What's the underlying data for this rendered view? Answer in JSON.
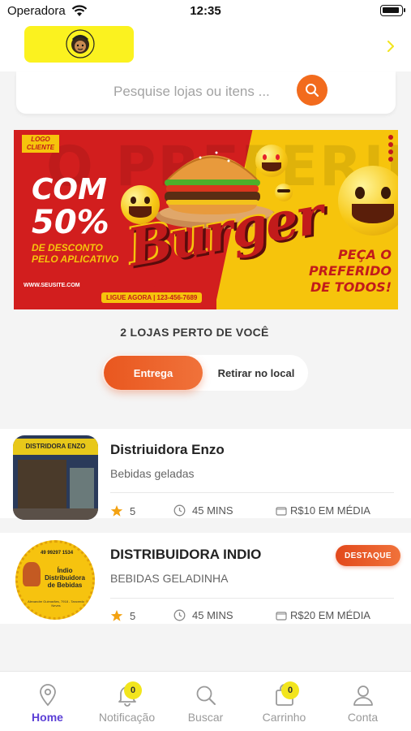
{
  "status_bar": {
    "carrier": "Operadora",
    "time": "12:35"
  },
  "header": {
    "logo_icon": "brand-logo-icon",
    "chevron_icon": "chevron-right-icon"
  },
  "search": {
    "placeholder": "Pesquise lojas ou itens ...",
    "icon": "search-icon"
  },
  "banner": {
    "logo_label": "LOGO CLIENTE",
    "headline_com": "COM",
    "headline_pct": "50%",
    "subline": "DE DESCONTO PELO APLICATIVO",
    "website": "WWW.SEUSITE.COM",
    "phone": "LIGUE AGORA | 123-456-7689",
    "title": "Burger",
    "right_text": "PEÇA O PREFERIDO DE TODOS!",
    "background_text": "O PREFERIDO"
  },
  "stores_heading": "2 LOJAS PERTO DE VOCÊ",
  "delivery_toggle": {
    "active": "Entrega",
    "inactive": "Retirar no local"
  },
  "stores": [
    {
      "name": "Distriuidora Enzo",
      "description": "Bebidas geladas",
      "rating": "5",
      "time": "45 MINS",
      "price": "R$10 EM MÉDIA",
      "badge": "",
      "thumb_sign": "DISTRIDORA ENZO"
    },
    {
      "name": "DISTRIBUIDORA INDIO",
      "description": "BEBIDAS GELADINHA",
      "rating": "5",
      "time": "45 MINS",
      "price": "R$20 EM MÉDIA",
      "badge": "DESTAQUE",
      "thumb_phone": "49 99297 1534",
      "thumb_title": "Índio Distribuidora de Bebidas",
      "thumb_address": "Alexandre Guimarães, 7918 - Tancredo Neves"
    }
  ],
  "tabbar": {
    "items": [
      {
        "label": "Home",
        "icon": "location-pin-icon",
        "active": true
      },
      {
        "label": "Notificação",
        "icon": "bell-icon",
        "count": "0"
      },
      {
        "label": "Buscar",
        "icon": "search-icon"
      },
      {
        "label": "Carrinho",
        "icon": "bag-icon",
        "count": "0"
      },
      {
        "label": "Conta",
        "icon": "user-icon"
      }
    ]
  },
  "colors": {
    "accent": "#f26b1d",
    "tab_active": "#5b3fd6",
    "logo_bg": "#fbf21f",
    "badge": "#e2491c"
  }
}
